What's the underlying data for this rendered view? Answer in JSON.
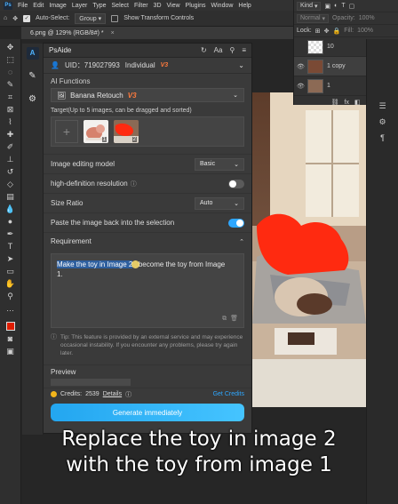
{
  "menubar": {
    "app": "Ps",
    "items": [
      "File",
      "Edit",
      "Image",
      "Layer",
      "Type",
      "Select",
      "Filter",
      "3D",
      "View",
      "Plugins",
      "Window",
      "Help"
    ]
  },
  "options": {
    "auto_select": "Auto-Select:",
    "group": "Group",
    "show_transform": "Show Transform Controls"
  },
  "document": {
    "tab_title": "6.png @ 129% (RGB/8#) *",
    "close": "×"
  },
  "layers": {
    "kind": "Kind",
    "blend_mode": "Normal",
    "opacity_label": "Opacity:",
    "opacity": "100%",
    "lock_label": "Lock:",
    "fill_label": "Fill:",
    "fill": "100%",
    "items": [
      {
        "name": "10"
      },
      {
        "name": "1 copy"
      },
      {
        "name": "1"
      }
    ]
  },
  "plugin": {
    "title": "PsAide",
    "uid": "UID：719027993",
    "membership": "Individual",
    "membership_tag": "V3",
    "ai_functions_label": "AI Functions",
    "ai_function_value": "Banana Retouch",
    "ai_function_tag": "V3",
    "target_label": "Target(Up to 5 images, can be dragged and sorted)",
    "target_images": [
      {
        "num": "1"
      },
      {
        "num": "2"
      }
    ],
    "model_label": "Image editing model",
    "model_value": "Basic",
    "hd_label": "high-definition resolution",
    "hd_on": false,
    "size_label": "Size Ratio",
    "size_value": "Auto",
    "paste_label": "Paste the image back into the selection",
    "paste_on": true,
    "requirement_label": "Requirement",
    "requirement_selected": "Make the toy in Image 2",
    "requirement_rest_1": "become the toy from Image",
    "requirement_rest_2": "1.",
    "tip": "Tip: This feature is provided by an external service and may experience occasional instability. If you encounter any problems, please try again later.",
    "preview_label": "Preview",
    "credits_label": "Credits:",
    "credits_value": "2539",
    "details_label": "Details",
    "get_credits_label": "Get Credits",
    "generate_label": "Generate immediately"
  },
  "caption": {
    "line1": "Replace the toy in image 2",
    "line2": "with the toy from image 1"
  },
  "colors": {
    "accent": "#2ea7ff",
    "vip": "#ff7a3d",
    "foreground_swatch": "#e01d00"
  }
}
